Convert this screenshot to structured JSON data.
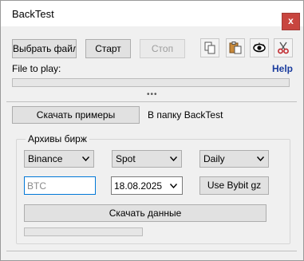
{
  "window": {
    "title": "BackTest",
    "close_label": "x"
  },
  "toolbar": {
    "choose_file_label": "Выбрать файл",
    "start_label": "Старт",
    "stop_label": "Стоп"
  },
  "file_section": {
    "label": "File to play:",
    "help_label": "Help",
    "progress": 0
  },
  "splitter": {
    "grip": "•••"
  },
  "examples": {
    "download_label": "Скачать примеры",
    "folder_text": "В папку BackTest"
  },
  "archives": {
    "legend": "Архивы бирж",
    "exchange": "Binance",
    "market": "Spot",
    "interval": "Daily",
    "symbol_placeholder": "BTC",
    "date": "18.08.2025",
    "bybit_label": "Use Bybit gz",
    "download_data_label": "Скачать данные",
    "progress": 0
  },
  "icons": {
    "copy": "copy-icon",
    "paste": "paste-icon",
    "view": "eye-icon",
    "cut": "scissors-icon"
  },
  "colors": {
    "close": "#c8453f",
    "help_link": "#1a3c9e",
    "focus_border": "#0078d7"
  }
}
